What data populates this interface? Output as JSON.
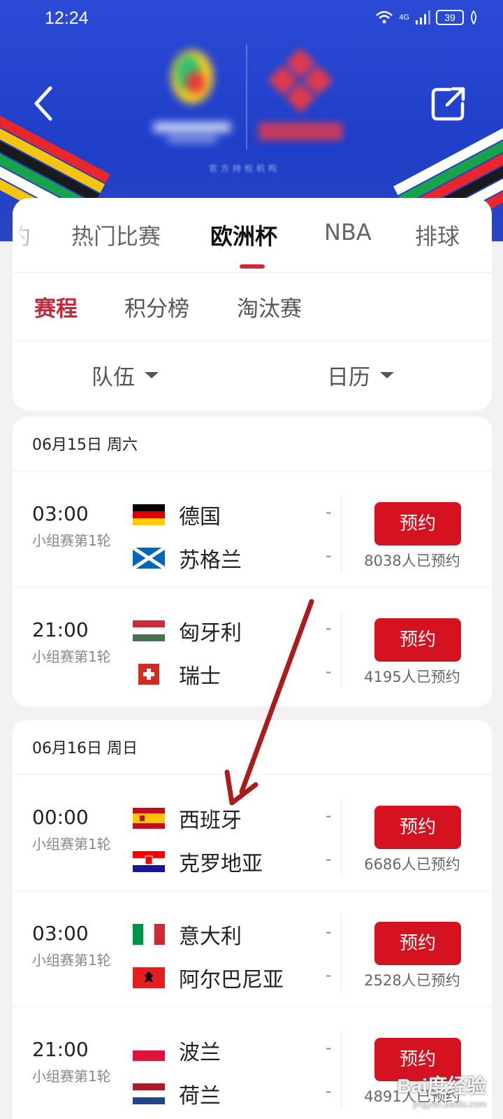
{
  "status_bar": {
    "time": "12:24",
    "network": "4G",
    "battery": "39"
  },
  "hero": {
    "caption": "官方持权机构"
  },
  "top_tabs": [
    {
      "label": "约",
      "active": false
    },
    {
      "label": "热门比赛",
      "active": false
    },
    {
      "label": "欧洲杯",
      "active": true
    },
    {
      "label": "NBA",
      "active": false
    },
    {
      "label": "排球",
      "active": false
    }
  ],
  "sub_tabs": [
    {
      "label": "赛程",
      "active": true
    },
    {
      "label": "积分榜",
      "active": false
    },
    {
      "label": "淘汰赛",
      "active": false
    }
  ],
  "filters": {
    "team": "队伍",
    "calendar": "日历"
  },
  "days": [
    {
      "date": "06月15日 周六",
      "matches": [
        {
          "time": "03:00",
          "round": "小组赛第1轮",
          "home": "德国",
          "away": "苏格兰",
          "home_score": "-",
          "away_score": "-",
          "button": "预约",
          "count": "8038人已预约"
        },
        {
          "time": "21:00",
          "round": "小组赛第1轮",
          "home": "匈牙利",
          "away": "瑞士",
          "home_score": "-",
          "away_score": "-",
          "button": "预约",
          "count": "4195人已预约"
        }
      ]
    },
    {
      "date": "06月16日 周日",
      "matches": [
        {
          "time": "00:00",
          "round": "小组赛第1轮",
          "home": "西班牙",
          "away": "克罗地亚",
          "home_score": "-",
          "away_score": "-",
          "button": "预约",
          "count": "6686人已预约"
        },
        {
          "time": "03:00",
          "round": "小组赛第1轮",
          "home": "意大利",
          "away": "阿尔巴尼亚",
          "home_score": "-",
          "away_score": "-",
          "button": "预约",
          "count": "2528人已预约"
        },
        {
          "time": "21:00",
          "round": "小组赛第1轮",
          "home": "波兰",
          "away": "荷兰",
          "home_score": "-",
          "away_score": "-",
          "button": "预约",
          "count": "4891人已预约"
        }
      ]
    }
  ],
  "watermark": {
    "main": "Bai度经验",
    "sub": "jingyan.baidu.com"
  },
  "colors": {
    "accent": "#d5121f",
    "active_sub_tab": "#c4283a",
    "hero_blue": "#2344cf"
  }
}
